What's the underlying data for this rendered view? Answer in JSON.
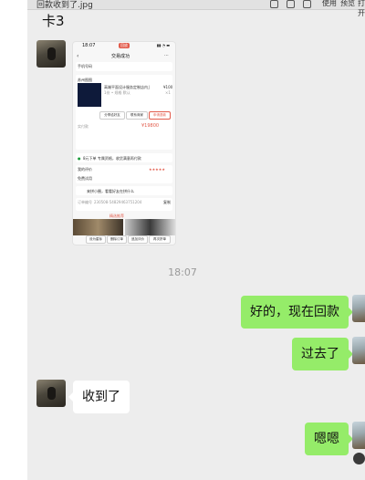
{
  "titlebar": {
    "filename": "回款收到了.jpg",
    "actions": [
      "使用",
      "预览",
      "打开"
    ]
  },
  "chat": {
    "title": "卡3",
    "timestamp": "18:07"
  },
  "screenshot": {
    "status_time": "18:07",
    "status_badge": "回放",
    "page_title": "交易成功",
    "row1": "手机号码",
    "shop": "苏州图图",
    "product": "高端平面设计服务定制店内上平面海报...",
    "product_sub": "1份 • 规格 默认",
    "price": "¥100",
    "qty": "×1",
    "btn_share": "分享给好友",
    "btn_contact": "联系商家",
    "btn_refund": "申请退款",
    "total_label": "实付款",
    "total": "¥19800",
    "installment": "8元下单 专属资格，收货满意再付款",
    "rating_label": "我的评价",
    "rating_stars": "★★★★★",
    "no_worry": "免费试用",
    "recommend": "来拼小圈，看看好友在拼什么",
    "order_label": "订单编号",
    "order_no": "230508-54829463751204",
    "copy": "复制",
    "section": "精选推荐",
    "actions": [
      "设为星标",
      "删除订单",
      "追加评价",
      "再次拼单"
    ]
  },
  "messages": [
    {
      "side": "right",
      "text": "好的，现在回款"
    },
    {
      "side": "right",
      "text": "过去了"
    },
    {
      "side": "left",
      "text": "收到了"
    },
    {
      "side": "right",
      "text": "嗯嗯"
    }
  ]
}
